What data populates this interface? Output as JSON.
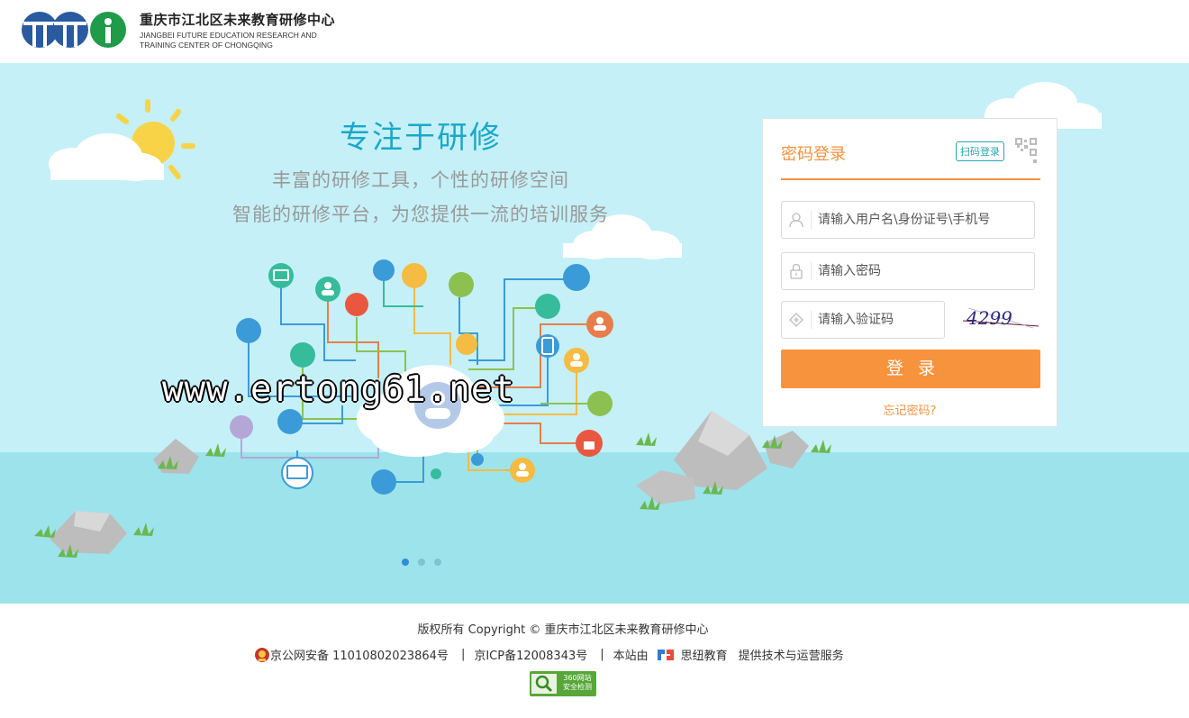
{
  "header": {
    "brand_cn": "重庆市江北区未来教育研修中心",
    "brand_en_1": "JIANGBEI FUTURE EDUCATION RESEARCH AND",
    "brand_en_2": "TRAINING CENTER OF CHONGQING"
  },
  "banner": {
    "headline": "专注于研修",
    "subline_1": "丰富的研修工具，个性的研修空间",
    "subline_2": "智能的研修平台，为您提供一流的培训服务",
    "watermark": "www.ertong61.net",
    "carousel_active_index": 0,
    "carousel_count": 3
  },
  "login": {
    "title": "密码登录",
    "qr_tab": "扫码登录",
    "username_placeholder": "请输入用户名\\身份证号\\手机号",
    "password_placeholder": "请输入密码",
    "captcha_placeholder": "请输入验证码",
    "captcha_text": "4299",
    "submit_label": "登录",
    "forgot_label": "忘记密码?"
  },
  "footer": {
    "copyright": "版权所有 Copyright © 重庆市江北区未来教育研修中心",
    "police_record": "京公网安备 11010802023864号",
    "icp_record": "京ICP备12008343号",
    "site_by": "本站由",
    "provider": "思纽教育",
    "service": "提供技术与运营服务",
    "badge_line1": "360网站",
    "badge_line2": "安全检测"
  },
  "colors": {
    "accent": "#f7933d",
    "banner_sky": "#c5f0f7",
    "banner_ground": "#9de3ec",
    "headline": "#1aa8c8",
    "logo_blue": "#2a5aa0",
    "logo_green": "#1f9b4a"
  }
}
